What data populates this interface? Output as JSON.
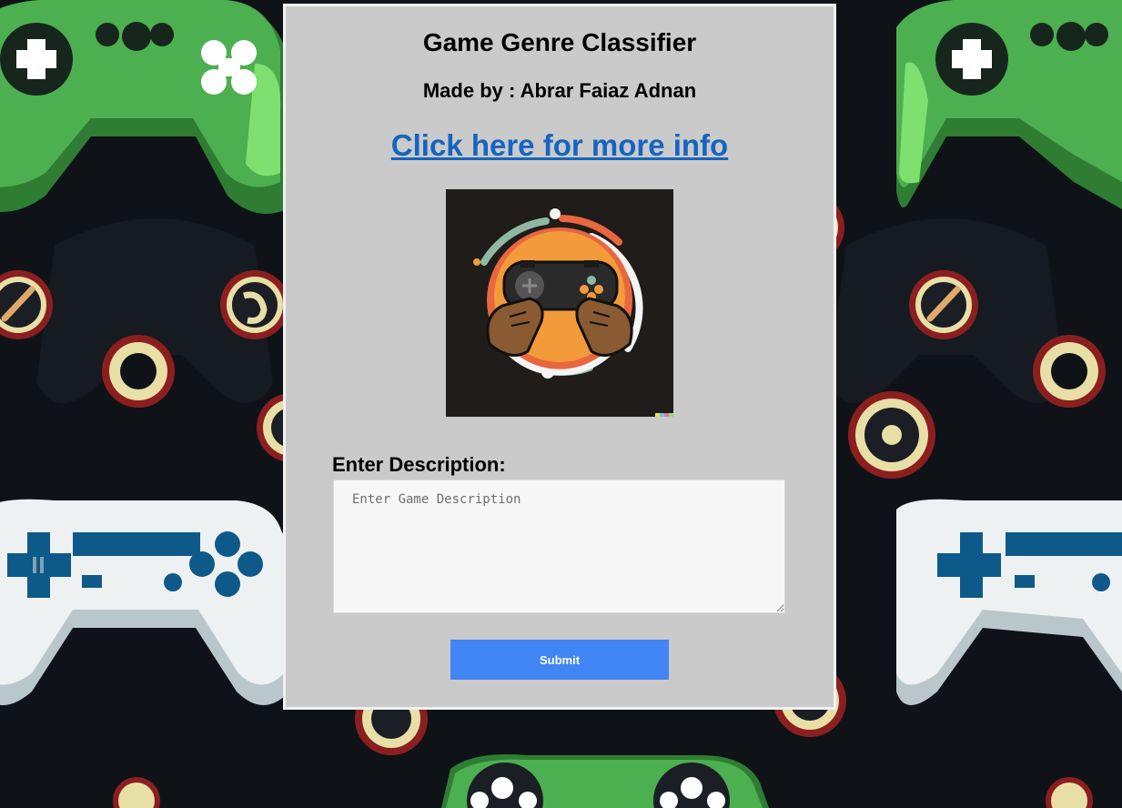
{
  "page": {
    "title": "Game Genre Classifier",
    "subtitle": "Made by : Abrar Faiaz Adnan",
    "info_link": "Click here for more info"
  },
  "logo": {
    "icon": "gamepad-hands-logo",
    "colors": {
      "background": "#1f1c19",
      "orange": "#f39a3a",
      "coral": "#e8673f",
      "sage": "#8fb8a3",
      "skin": "#8a5a32"
    }
  },
  "form": {
    "label": "Enter Description:",
    "description_placeholder": "Enter Game Description",
    "description_value": "",
    "submit_label": "Submit"
  },
  "colors": {
    "panel_bg": "#cacaca",
    "link": "#1565c0",
    "button": "#4285f4",
    "background": "#0f1318",
    "controller_green": "#4caf50",
    "controller_white": "#eef1f2"
  }
}
